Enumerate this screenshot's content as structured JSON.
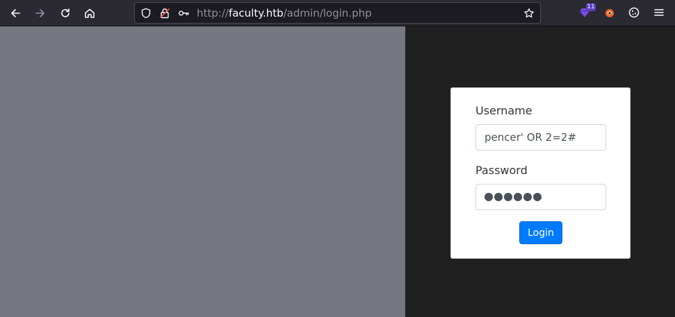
{
  "browser": {
    "url": {
      "scheme": "http://",
      "host": "faculty.htb",
      "path": "/admin/login.php"
    },
    "extensions": [
      {
        "name": "ublock-ext",
        "badge": "11"
      },
      {
        "name": "fox-ext"
      },
      {
        "name": "cookie-ext"
      }
    ],
    "icons": {
      "back": "back-arrow-icon",
      "forward": "forward-arrow-icon",
      "reload": "reload-icon",
      "home": "home-icon",
      "shield": "tracking-shield-icon",
      "insecure": "insecure-lock-icon",
      "key": "key-icon",
      "bookmark": "bookmark-star-icon",
      "menu": "hamburger-menu-icon"
    }
  },
  "login": {
    "username_label": "Username",
    "username_value": "pencer' OR 2=2#",
    "password_label": "Password",
    "password_dot_count": 6,
    "submit_label": "Login"
  },
  "colors": {
    "left_pane": "#767881",
    "right_pane": "#202020",
    "primary_button": "#007bff"
  }
}
